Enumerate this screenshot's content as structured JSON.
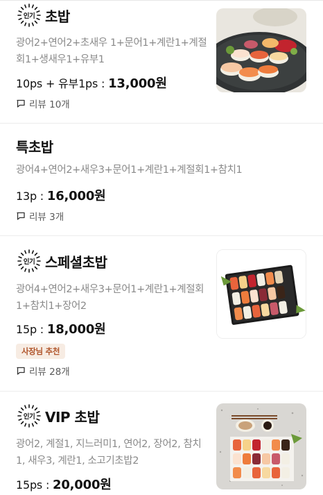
{
  "popular_badge": "인기",
  "menu_items": [
    {
      "name": "초밥",
      "has_popular_badge": true,
      "description": "광어2+연어2+초새우 1+문어1+계란1+계절회1+생새우1+유부1",
      "price_prefix": "10ps + 유부1ps : ",
      "price": "13,000원",
      "review": "리뷰 10개",
      "has_image": true
    },
    {
      "name": "특초밥",
      "has_popular_badge": false,
      "description": "광어4+연어2+새우3+문어1+계란1+계절회1+참치1",
      "price_prefix": "13p : ",
      "price": "16,000원",
      "review": "리뷰 3개",
      "has_image": false
    },
    {
      "name": "스페셜초밥",
      "has_popular_badge": true,
      "description": "광어4+연어2+새우3+문어1+계란1+계절회1+참치1+장어2",
      "price_prefix": "15p : ",
      "price": "18,000원",
      "tag": "사장님 추천",
      "review": "리뷰 28개",
      "has_image": true
    },
    {
      "name": "VIP 초밥",
      "has_popular_badge": true,
      "description": "광어2, 계절1, 지느러미1, 연어2, 장어2, 참치1, 새우3, 계란1, 소고기초밥2",
      "price_prefix": "15ps : ",
      "price": "20,000원",
      "has_image": true
    }
  ],
  "colors": {
    "tag_bg": "#f7ece3",
    "tag_text": "#b0542a",
    "muted_text": "#8a8a8a"
  }
}
